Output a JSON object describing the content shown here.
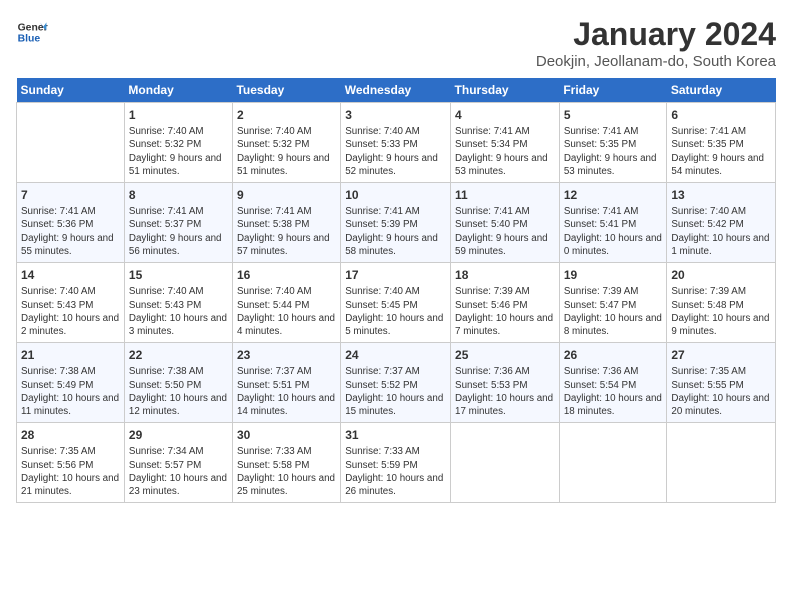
{
  "header": {
    "logo_general": "General",
    "logo_blue": "Blue",
    "month": "January 2024",
    "location": "Deokjin, Jeollanam-do, South Korea"
  },
  "days_of_week": [
    "Sunday",
    "Monday",
    "Tuesday",
    "Wednesday",
    "Thursday",
    "Friday",
    "Saturday"
  ],
  "weeks": [
    [
      {
        "day": "",
        "empty": true
      },
      {
        "day": "1",
        "sunrise": "7:40 AM",
        "sunset": "5:32 PM",
        "daylight": "9 hours and 51 minutes."
      },
      {
        "day": "2",
        "sunrise": "7:40 AM",
        "sunset": "5:32 PM",
        "daylight": "9 hours and 51 minutes."
      },
      {
        "day": "3",
        "sunrise": "7:40 AM",
        "sunset": "5:33 PM",
        "daylight": "9 hours and 52 minutes."
      },
      {
        "day": "4",
        "sunrise": "7:41 AM",
        "sunset": "5:34 PM",
        "daylight": "9 hours and 53 minutes."
      },
      {
        "day": "5",
        "sunrise": "7:41 AM",
        "sunset": "5:35 PM",
        "daylight": "9 hours and 53 minutes."
      },
      {
        "day": "6",
        "sunrise": "7:41 AM",
        "sunset": "5:35 PM",
        "daylight": "9 hours and 54 minutes."
      }
    ],
    [
      {
        "day": "7",
        "sunrise": "7:41 AM",
        "sunset": "5:36 PM",
        "daylight": "9 hours and 55 minutes."
      },
      {
        "day": "8",
        "sunrise": "7:41 AM",
        "sunset": "5:37 PM",
        "daylight": "9 hours and 56 minutes."
      },
      {
        "day": "9",
        "sunrise": "7:41 AM",
        "sunset": "5:38 PM",
        "daylight": "9 hours and 57 minutes."
      },
      {
        "day": "10",
        "sunrise": "7:41 AM",
        "sunset": "5:39 PM",
        "daylight": "9 hours and 58 minutes."
      },
      {
        "day": "11",
        "sunrise": "7:41 AM",
        "sunset": "5:40 PM",
        "daylight": "9 hours and 59 minutes."
      },
      {
        "day": "12",
        "sunrise": "7:41 AM",
        "sunset": "5:41 PM",
        "daylight": "10 hours and 0 minutes."
      },
      {
        "day": "13",
        "sunrise": "7:40 AM",
        "sunset": "5:42 PM",
        "daylight": "10 hours and 1 minute."
      }
    ],
    [
      {
        "day": "14",
        "sunrise": "7:40 AM",
        "sunset": "5:43 PM",
        "daylight": "10 hours and 2 minutes."
      },
      {
        "day": "15",
        "sunrise": "7:40 AM",
        "sunset": "5:43 PM",
        "daylight": "10 hours and 3 minutes."
      },
      {
        "day": "16",
        "sunrise": "7:40 AM",
        "sunset": "5:44 PM",
        "daylight": "10 hours and 4 minutes."
      },
      {
        "day": "17",
        "sunrise": "7:40 AM",
        "sunset": "5:45 PM",
        "daylight": "10 hours and 5 minutes."
      },
      {
        "day": "18",
        "sunrise": "7:39 AM",
        "sunset": "5:46 PM",
        "daylight": "10 hours and 7 minutes."
      },
      {
        "day": "19",
        "sunrise": "7:39 AM",
        "sunset": "5:47 PM",
        "daylight": "10 hours and 8 minutes."
      },
      {
        "day": "20",
        "sunrise": "7:39 AM",
        "sunset": "5:48 PM",
        "daylight": "10 hours and 9 minutes."
      }
    ],
    [
      {
        "day": "21",
        "sunrise": "7:38 AM",
        "sunset": "5:49 PM",
        "daylight": "10 hours and 11 minutes."
      },
      {
        "day": "22",
        "sunrise": "7:38 AM",
        "sunset": "5:50 PM",
        "daylight": "10 hours and 12 minutes."
      },
      {
        "day": "23",
        "sunrise": "7:37 AM",
        "sunset": "5:51 PM",
        "daylight": "10 hours and 14 minutes."
      },
      {
        "day": "24",
        "sunrise": "7:37 AM",
        "sunset": "5:52 PM",
        "daylight": "10 hours and 15 minutes."
      },
      {
        "day": "25",
        "sunrise": "7:36 AM",
        "sunset": "5:53 PM",
        "daylight": "10 hours and 17 minutes."
      },
      {
        "day": "26",
        "sunrise": "7:36 AM",
        "sunset": "5:54 PM",
        "daylight": "10 hours and 18 minutes."
      },
      {
        "day": "27",
        "sunrise": "7:35 AM",
        "sunset": "5:55 PM",
        "daylight": "10 hours and 20 minutes."
      }
    ],
    [
      {
        "day": "28",
        "sunrise": "7:35 AM",
        "sunset": "5:56 PM",
        "daylight": "10 hours and 21 minutes."
      },
      {
        "day": "29",
        "sunrise": "7:34 AM",
        "sunset": "5:57 PM",
        "daylight": "10 hours and 23 minutes."
      },
      {
        "day": "30",
        "sunrise": "7:33 AM",
        "sunset": "5:58 PM",
        "daylight": "10 hours and 25 minutes."
      },
      {
        "day": "31",
        "sunrise": "7:33 AM",
        "sunset": "5:59 PM",
        "daylight": "10 hours and 26 minutes."
      },
      {
        "day": "",
        "empty": true
      },
      {
        "day": "",
        "empty": true
      },
      {
        "day": "",
        "empty": true
      }
    ]
  ]
}
